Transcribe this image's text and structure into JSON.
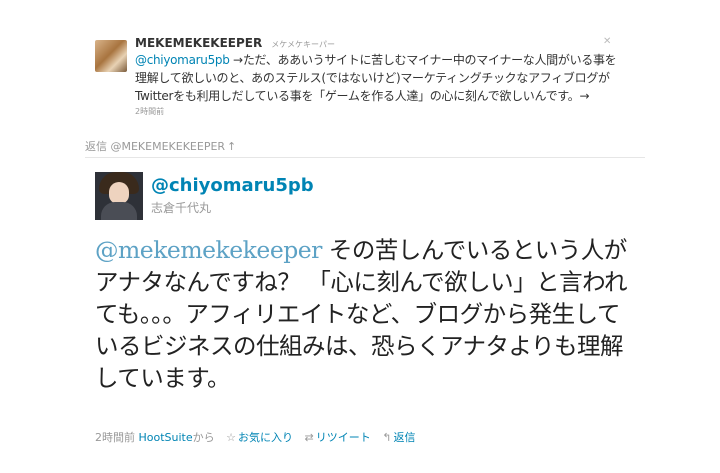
{
  "parent_tweet": {
    "screen_name": "MEKEMEKEKEEPER",
    "full_name": "メケメケキーパー",
    "mention": "@chiyomaru5pb",
    "text": " →ただ、ああいうサイトに苦しむマイナー中のマイナーな人間がいる事を理解して欲しいのと、あのステルス(ではないけど)マーケティングチックなアフィブログがTwitterをも利用しだしている事を「ゲームを作る人達」の心に刻んで欲しいんです。→",
    "time": "2時間前",
    "avatar_icon": "avatar-icon"
  },
  "in_reply": {
    "label": "返信 @MEKEMEKEKEEPER",
    "arrow": "↑"
  },
  "main_tweet": {
    "screen_name": "@chiyomaru5pb",
    "full_name": "志倉千代丸",
    "mention": "@mekemekekeeper",
    "text": " その苦しんでいるという人がアナタなんですね？ 「心に刻んで欲しい」と言われても。。。アフィリエイトなど、ブログから発生しているビジネスの仕組みは、恐らくアナタよりも理解しています。"
  },
  "meta": {
    "time": "2時間前",
    "via_prefix": "",
    "via": "HootSuite",
    "via_suffix": "から",
    "favorite": "お気に入り",
    "retweet": "リツイート",
    "reply": "返信"
  },
  "icons": {
    "favorite": "star-icon",
    "retweet": "retweet-icon",
    "reply": "reply-icon"
  }
}
